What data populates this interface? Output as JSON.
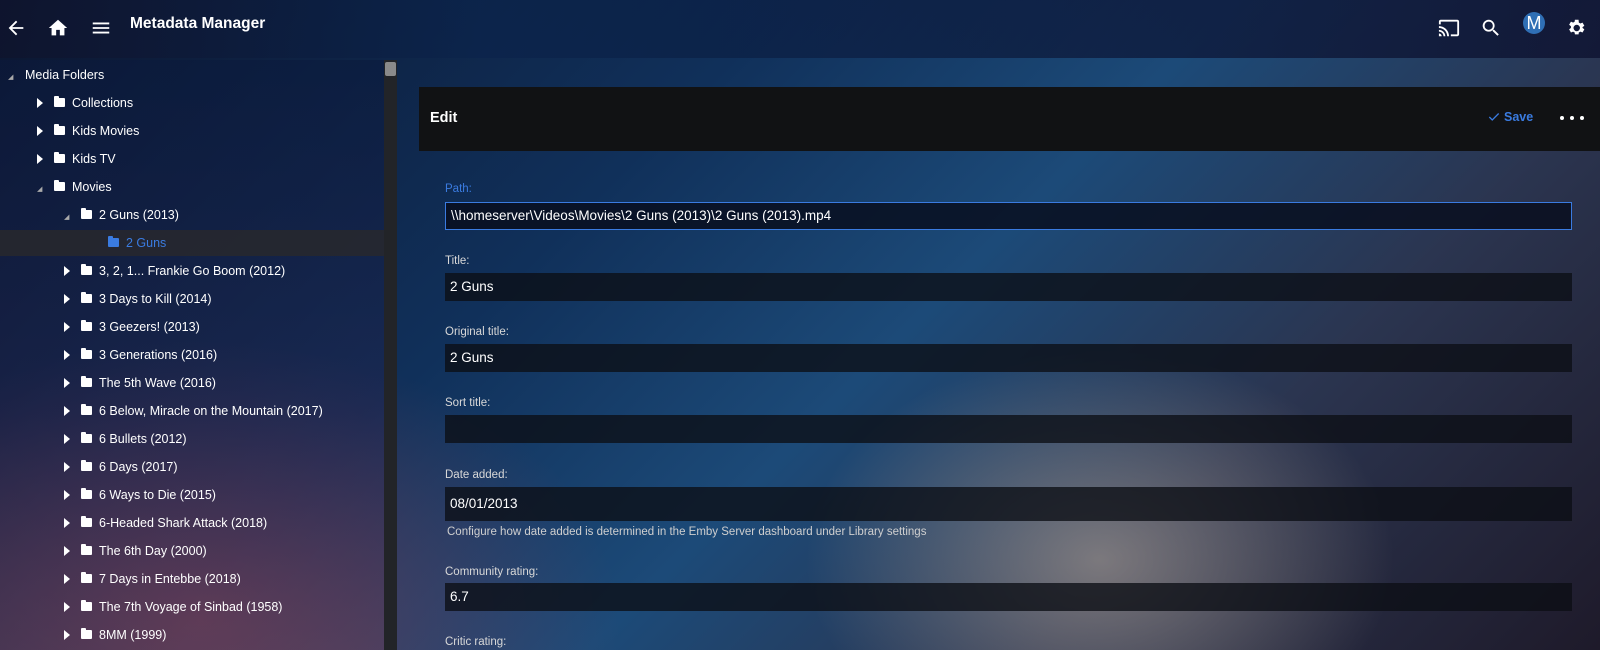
{
  "header": {
    "title": "Metadata Manager",
    "icons": [
      "back-arrow-icon",
      "home-icon",
      "menu-icon",
      "cast-icon",
      "search-icon",
      "user-avatar",
      "settings-gear-icon"
    ],
    "avatar_letter": "M"
  },
  "tree": {
    "root": "Media Folders",
    "items": [
      {
        "label": "Collections",
        "state": "closed"
      },
      {
        "label": "Kids Movies",
        "state": "closed"
      },
      {
        "label": "Kids TV",
        "state": "closed"
      },
      {
        "label": "Movies",
        "state": "open"
      },
      {
        "label": "2 Guns (2013)",
        "state": "open"
      },
      {
        "label": "2 Guns",
        "state": "selected"
      },
      {
        "label": "3, 2, 1... Frankie Go Boom (2012)",
        "state": "closed"
      },
      {
        "label": "3 Days to Kill (2014)",
        "state": "closed"
      },
      {
        "label": "3 Geezers! (2013)",
        "state": "closed"
      },
      {
        "label": "3 Generations (2016)",
        "state": "closed"
      },
      {
        "label": "The 5th Wave (2016)",
        "state": "closed"
      },
      {
        "label": "6 Below, Miracle on the Mountain (2017)",
        "state": "closed"
      },
      {
        "label": "6 Bullets (2012)",
        "state": "closed"
      },
      {
        "label": "6 Days (2017)",
        "state": "closed"
      },
      {
        "label": "6 Ways to Die (2015)",
        "state": "closed"
      },
      {
        "label": "6-Headed Shark Attack (2018)",
        "state": "closed"
      },
      {
        "label": "The 6th Day (2000)",
        "state": "closed"
      },
      {
        "label": "7 Days in Entebbe (2018)",
        "state": "closed"
      },
      {
        "label": "The 7th Voyage of Sinbad (1958)",
        "state": "closed"
      },
      {
        "label": "8MM (1999)",
        "state": "closed"
      }
    ]
  },
  "edit": {
    "title": "Edit",
    "save_label": "Save",
    "accent": "#3a7be0",
    "fields": {
      "path": {
        "label": "Path:",
        "value": "\\\\homeserver\\Videos\\Movies\\2 Guns (2013)\\2 Guns (2013).mp4"
      },
      "title": {
        "label": "Title:",
        "value": "2 Guns"
      },
      "original_title": {
        "label": "Original title:",
        "value": "2 Guns"
      },
      "sort_title": {
        "label": "Sort title:",
        "value": ""
      },
      "date_added": {
        "label": "Date added:",
        "value": "08/01/2013",
        "hint": "Configure how date added is determined in the Emby Server dashboard under Library settings"
      },
      "community_rating": {
        "label": "Community rating:",
        "value": "6.7"
      },
      "critic_rating": {
        "label": "Critic rating:"
      }
    }
  }
}
